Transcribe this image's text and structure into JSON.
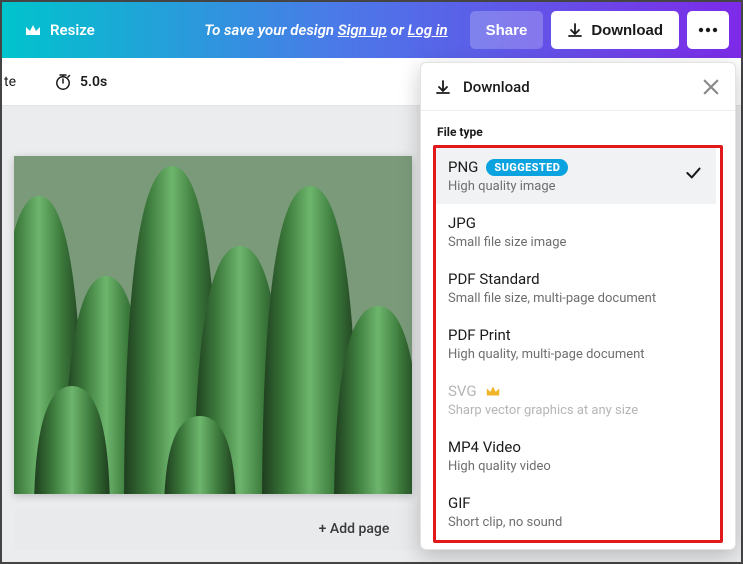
{
  "header": {
    "resize_label": "Resize",
    "save_prefix": "To save your design ",
    "signup_label": "Sign up",
    "save_sep": " or ",
    "login_label": "Log in",
    "share_label": "Share",
    "download_label": "Download"
  },
  "toolbar": {
    "animate_trailing": "te",
    "timer_value": "5.0s"
  },
  "canvas": {
    "add_page_label": "+ Add page"
  },
  "download_panel": {
    "title": "Download",
    "file_type_label": "File type",
    "items": [
      {
        "name": "PNG",
        "desc": "High quality image",
        "suggested_label": "SUGGESTED",
        "selected": true,
        "premium": false
      },
      {
        "name": "JPG",
        "desc": "Small file size image",
        "selected": false,
        "premium": false
      },
      {
        "name": "PDF Standard",
        "desc": "Small file size, multi-page document",
        "selected": false,
        "premium": false
      },
      {
        "name": "PDF Print",
        "desc": "High quality, multi-page document",
        "selected": false,
        "premium": false
      },
      {
        "name": "SVG",
        "desc": "Sharp vector graphics at any size",
        "selected": false,
        "premium": true
      },
      {
        "name": "MP4 Video",
        "desc": "High quality video",
        "selected": false,
        "premium": false
      },
      {
        "name": "GIF",
        "desc": "Short clip, no sound",
        "selected": false,
        "premium": false
      }
    ]
  },
  "colors": {
    "accent_purple": "#7d2ae8",
    "highlight_red": "#e01a1a",
    "crown_gold": "#f0b429",
    "suggested_blue": "#0aa3e0"
  }
}
